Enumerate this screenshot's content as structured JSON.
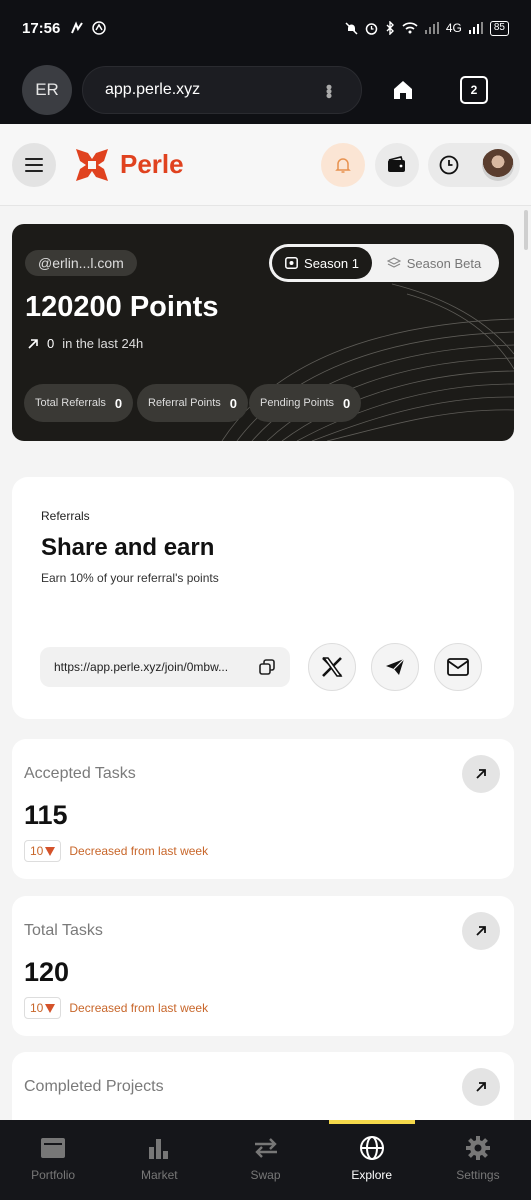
{
  "status_bar": {
    "time": "17:56",
    "network": "4G",
    "battery": "85"
  },
  "browser": {
    "avatar_initials": "ER",
    "url": "app.perle.xyz",
    "tabs_count": "2"
  },
  "header": {
    "logo_text": "Perle",
    "brand_color": "#e0421f"
  },
  "points_card": {
    "email": "@erlin...l.com",
    "season_active": "Season 1",
    "season_other": "Season Beta",
    "points": "120200 Points",
    "last24_value": "0",
    "last24_label": "in the last 24h",
    "stats": [
      {
        "label": "Total Referrals",
        "value": "0"
      },
      {
        "label": "Referral Points",
        "value": "0"
      },
      {
        "label": "Pending Points",
        "value": "0"
      }
    ]
  },
  "referrals": {
    "label": "Referrals",
    "title": "Share and earn",
    "subtitle": "Earn 10% of your referral's points",
    "link": "https://app.perle.xyz/join/0mbw..."
  },
  "stat_cards": [
    {
      "title": "Accepted Tasks",
      "value": "115",
      "delta": "10",
      "delta_text": "Decreased from last week"
    },
    {
      "title": "Total Tasks",
      "value": "120",
      "delta": "10",
      "delta_text": "Decreased from last week"
    },
    {
      "title": "Completed Projects",
      "value": "",
      "delta": "",
      "delta_text": ""
    }
  ],
  "bottom_nav": [
    {
      "label": "Portfolio",
      "icon": "portfolio-icon"
    },
    {
      "label": "Market",
      "icon": "bar-chart-icon"
    },
    {
      "label": "Swap",
      "icon": "swap-icon"
    },
    {
      "label": "Explore",
      "icon": "globe-icon",
      "active": true
    },
    {
      "label": "Settings",
      "icon": "gear-icon"
    }
  ]
}
